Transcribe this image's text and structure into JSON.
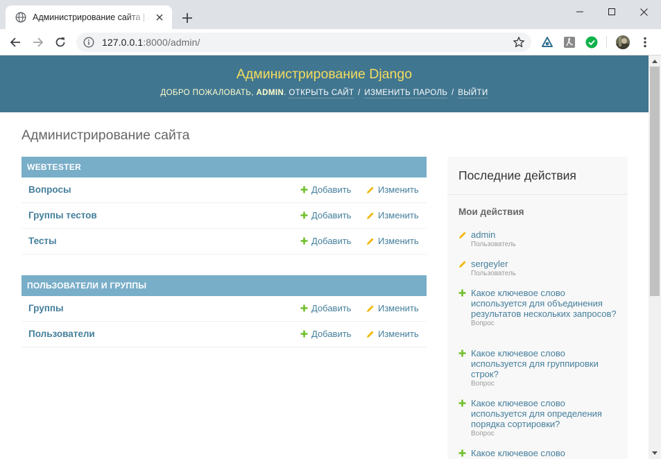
{
  "browser": {
    "tab_title": "Администрирование сайта | Администрирование Django",
    "url_host": "127.0.0.1",
    "url_rest": ":8000/admin/"
  },
  "header": {
    "site_name": "Администрирование Django",
    "welcome": "Добро пожаловать,",
    "username": "admin",
    "view_site": "Открыть сайт",
    "change_password": "Изменить пароль",
    "logout": "Выйти",
    "separator": "/"
  },
  "content": {
    "page_title": "Администрирование сайта",
    "add_label": "Добавить",
    "change_label": "Изменить",
    "apps": [
      {
        "caption": "Webtester",
        "models": [
          "Вопросы",
          "Группы тестов",
          "Тесты"
        ]
      },
      {
        "caption": "Пользователи и группы",
        "models": [
          "Группы",
          "Пользователи"
        ]
      }
    ]
  },
  "recent": {
    "title": "Последние действия",
    "subtitle": "Мои действия",
    "actions": [
      {
        "icon": "pencil-icon",
        "text": "admin",
        "type": "Пользователь"
      },
      {
        "icon": "pencil-icon",
        "text": "sergeyler",
        "type": "Пользователь"
      },
      {
        "icon": "plus-icon",
        "text": "Какое ключевое слово используется для объединения результатов нескольких запросов?",
        "type": "Вопрос"
      },
      {
        "icon": "plus-icon",
        "text": "Какое ключевое слово используется для группировки строк?",
        "type": "Вопрос"
      },
      {
        "icon": "plus-icon",
        "text": "Какое ключевое слово используется для определения порядка сортировки?",
        "type": "Вопрос"
      },
      {
        "icon": "plus-icon",
        "text": "Какое ключевое слово",
        "type": ""
      }
    ]
  },
  "colors": {
    "header_bg": "#417690",
    "site_name": "#f5dd5d",
    "module_caption": "#79aec8",
    "link": "#447e9b",
    "add_icon": "#70bf2b",
    "change_icon": "#efb80b"
  }
}
